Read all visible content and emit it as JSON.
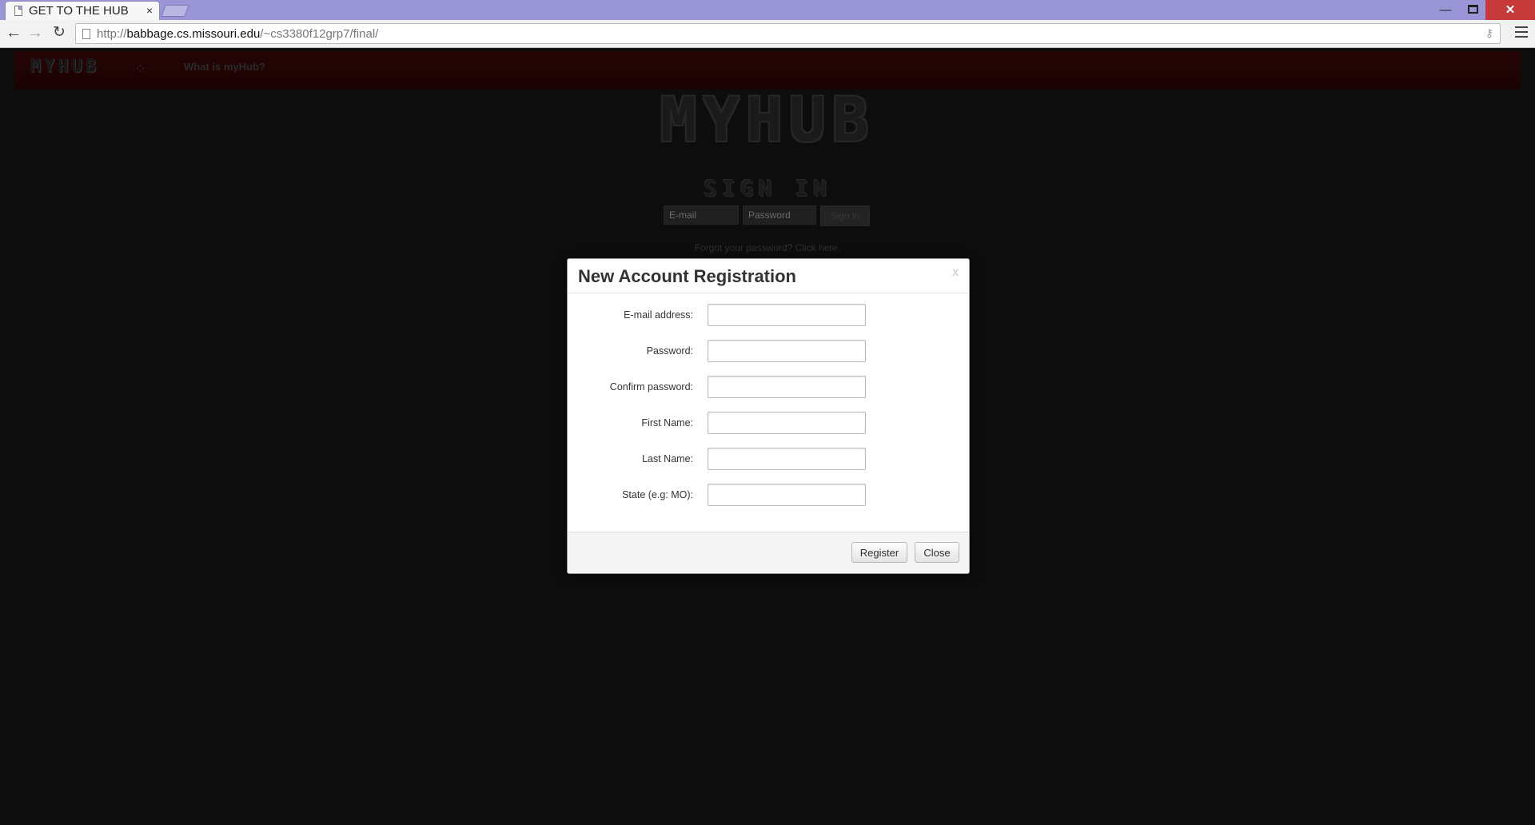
{
  "browser": {
    "tab_title": "GET TO THE HUB",
    "tab_close": "×",
    "url_prefix": "http://",
    "url_host": "babbage.cs.missouri.edu",
    "url_path": "/~cs3380f12grp7/final/",
    "window_minimize": "—",
    "window_close": "✕"
  },
  "navbar": {
    "logo": "MYHUB",
    "link": "What is myHub?"
  },
  "hero": {
    "logo": "MYHUB",
    "subtitle": "SIGN IN",
    "email_placeholder": "E-mail",
    "password_placeholder": "Password",
    "signin_button": "Sign in",
    "forgot": "Forgot your password? Click here."
  },
  "modal": {
    "title": "New Account Registration",
    "close_x": "x",
    "fields": [
      {
        "label": "E-mail address:",
        "value": ""
      },
      {
        "label": "Password:",
        "value": ""
      },
      {
        "label": "Confirm password:",
        "value": ""
      },
      {
        "label": "First Name:",
        "value": ""
      },
      {
        "label": "Last Name:",
        "value": ""
      },
      {
        "label": "State (e.g: MO):",
        "value": ""
      }
    ],
    "register_button": "Register",
    "close_button": "Close"
  }
}
